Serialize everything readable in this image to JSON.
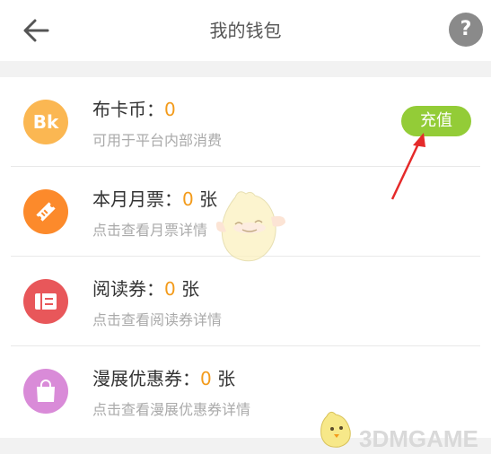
{
  "header": {
    "title": "我的钱包",
    "back_icon": "arrow-left-icon",
    "help_label": "?"
  },
  "wallet": {
    "items": [
      {
        "name": "布卡币",
        "colon": "：",
        "count": "0",
        "unit": "",
        "subtitle": "可用于平台内部消费",
        "icon": "bk-coin-icon",
        "icon_text": "Bk",
        "icon_color": "#fbb752"
      },
      {
        "name": "本月月票",
        "colon": "：",
        "count": "0",
        "unit": "张",
        "subtitle": "点击查看月票详情",
        "icon": "ticket-icon",
        "icon_color": "#fc8a2b"
      },
      {
        "name": "阅读券",
        "colon": "：",
        "count": "0",
        "unit": "张",
        "subtitle": "点击查看阅读券详情",
        "icon": "reading-coupon-icon",
        "icon_color": "#e8575a"
      },
      {
        "name": "漫展优惠券",
        "colon": "：",
        "count": "0",
        "unit": "张",
        "subtitle": "点击查看漫展优惠券详情",
        "icon": "shopping-bag-icon",
        "icon_color": "#d98bd8"
      }
    ],
    "recharge_label": "充值",
    "recharge_color": "#93cc37"
  },
  "watermark": {
    "text": "3DMGAME"
  }
}
